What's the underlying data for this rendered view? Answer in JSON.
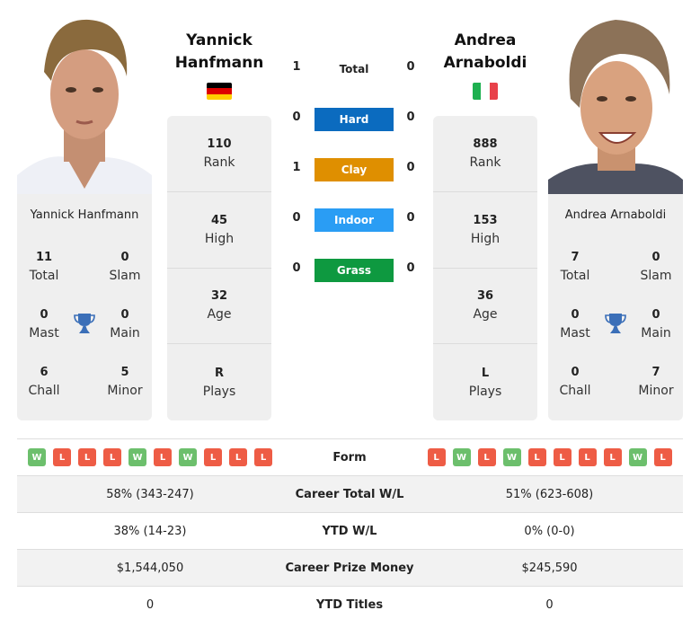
{
  "player1": {
    "name_line1": "Yannick",
    "name_line2": "Hanfmann",
    "full_name": "Yannick Hanfmann",
    "country": "Germany",
    "flag_colors": [
      "#000000",
      "#dd0000",
      "#ffce00"
    ],
    "stats": [
      {
        "value": "110",
        "label": "Rank"
      },
      {
        "value": "45",
        "label": "High"
      },
      {
        "value": "32",
        "label": "Age"
      },
      {
        "value": "R",
        "label": "Plays"
      }
    ],
    "titles": {
      "total": {
        "value": "11",
        "label": "Total"
      },
      "slam": {
        "value": "0",
        "label": "Slam"
      },
      "mast": {
        "value": "0",
        "label": "Mast"
      },
      "main": {
        "value": "0",
        "label": "Main"
      },
      "chall": {
        "value": "6",
        "label": "Chall"
      },
      "minor": {
        "value": "5",
        "label": "Minor"
      }
    },
    "form": [
      "W",
      "L",
      "L",
      "L",
      "W",
      "L",
      "W",
      "L",
      "L",
      "L"
    ],
    "career_total_wl": "58% (343-247)",
    "ytd_wl": "38% (14-23)",
    "career_prize_money": "$1,544,050",
    "ytd_titles": "0"
  },
  "player2": {
    "name_line1": "Andrea",
    "name_line2": "Arnaboldi",
    "full_name": "Andrea Arnaboldi",
    "country": "Italy",
    "flag_colors": [
      "#1eb050",
      "#ffffff",
      "#e8414a"
    ],
    "stats": [
      {
        "value": "888",
        "label": "Rank"
      },
      {
        "value": "153",
        "label": "High"
      },
      {
        "value": "36",
        "label": "Age"
      },
      {
        "value": "L",
        "label": "Plays"
      }
    ],
    "titles": {
      "total": {
        "value": "7",
        "label": "Total"
      },
      "slam": {
        "value": "0",
        "label": "Slam"
      },
      "mast": {
        "value": "0",
        "label": "Mast"
      },
      "main": {
        "value": "0",
        "label": "Main"
      },
      "chall": {
        "value": "0",
        "label": "Chall"
      },
      "minor": {
        "value": "7",
        "label": "Minor"
      }
    },
    "form": [
      "L",
      "W",
      "L",
      "W",
      "L",
      "L",
      "L",
      "L",
      "W",
      "L"
    ],
    "career_total_wl": "51% (623-608)",
    "ytd_wl": "0% (0-0)",
    "career_prize_money": "$245,590",
    "ytd_titles": "0"
  },
  "h2h": {
    "total": {
      "label": "Total",
      "p1": "1",
      "p2": "0"
    },
    "surfaces": [
      {
        "label": "Hard",
        "p1": "0",
        "p2": "0",
        "color": "#0b6bbf"
      },
      {
        "label": "Clay",
        "p1": "1",
        "p2": "0",
        "color": "#df8f00"
      },
      {
        "label": "Indoor",
        "p1": "0",
        "p2": "0",
        "color": "#2a9df4"
      },
      {
        "label": "Grass",
        "p1": "0",
        "p2": "0",
        "color": "#0e9940"
      }
    ]
  },
  "table_labels": {
    "form": "Form",
    "career_total_wl": "Career Total W/L",
    "ytd_wl": "YTD W/L",
    "career_prize_money": "Career Prize Money",
    "ytd_titles": "YTD Titles"
  },
  "colors": {
    "win": "#6cbf6c",
    "loss": "#ee5c45",
    "trophy": "#3b6fb8",
    "panel": "#efefef"
  }
}
